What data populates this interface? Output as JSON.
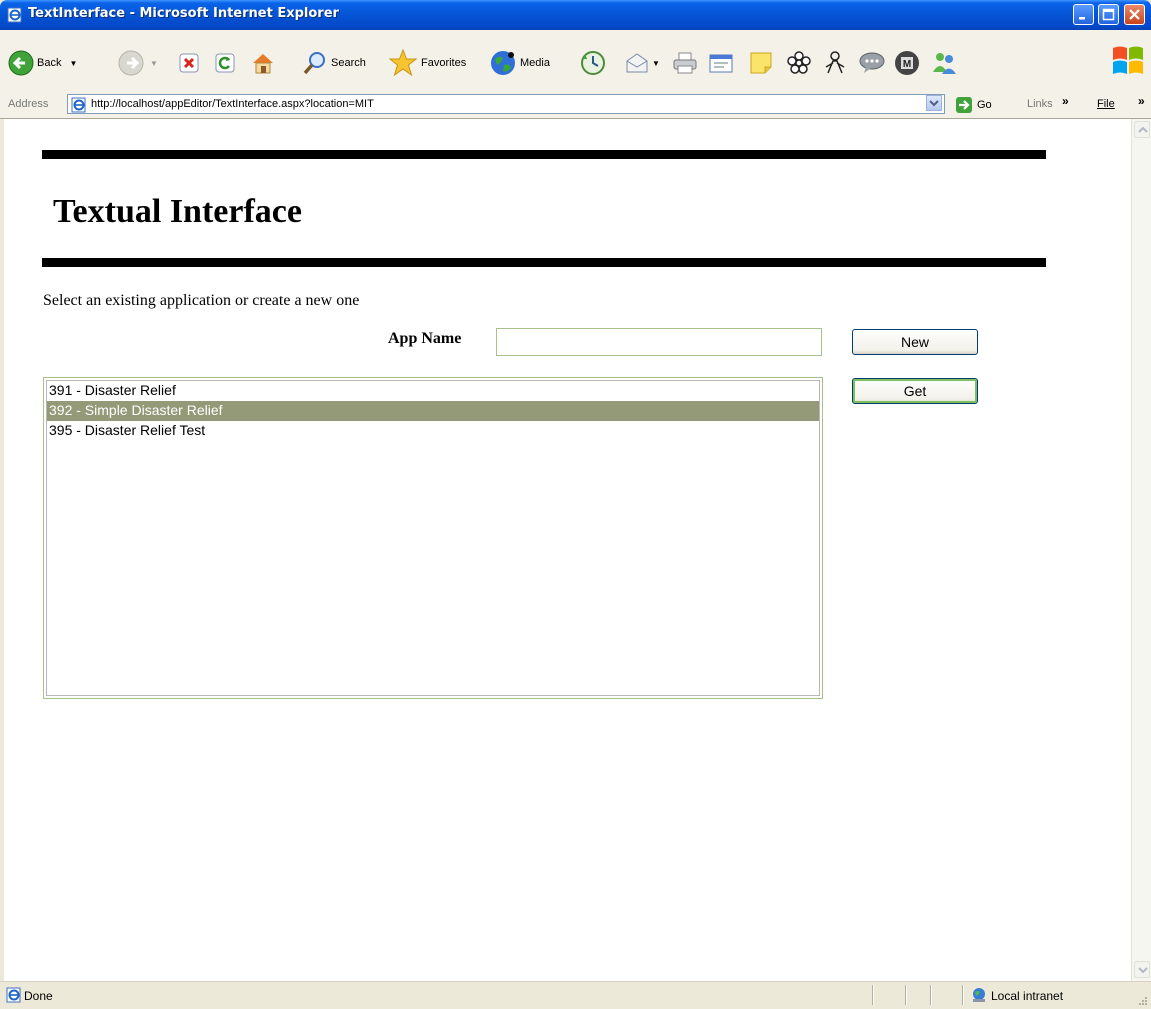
{
  "window": {
    "title": "TextInterface - Microsoft Internet Explorer"
  },
  "toolbar": {
    "back_label": "Back",
    "search_label": "Search",
    "favorites_label": "Favorites",
    "media_label": "Media"
  },
  "addressbar": {
    "label": "Address",
    "url": "http://localhost/appEditor/TextInterface.aspx?location=MIT",
    "go_label": "Go",
    "links_label": "Links",
    "file_menu": "File"
  },
  "page": {
    "heading": "Textual Interface",
    "instruction": "Select an existing application or create a new one",
    "app_name_label": "App Name",
    "app_name_value": "",
    "new_button": "New",
    "get_button": "Get",
    "applications": [
      {
        "label": "391 - Disaster Relief",
        "selected": false
      },
      {
        "label": "392 - Simple Disaster Relief",
        "selected": true
      },
      {
        "label": "395 - Disaster Relief Test",
        "selected": false
      }
    ]
  },
  "statusbar": {
    "status": "Done",
    "zone": "Local intranet"
  },
  "colors": {
    "titlebar": "#0553d4",
    "selection": "#949a77",
    "input_border": "#a5c28b"
  }
}
